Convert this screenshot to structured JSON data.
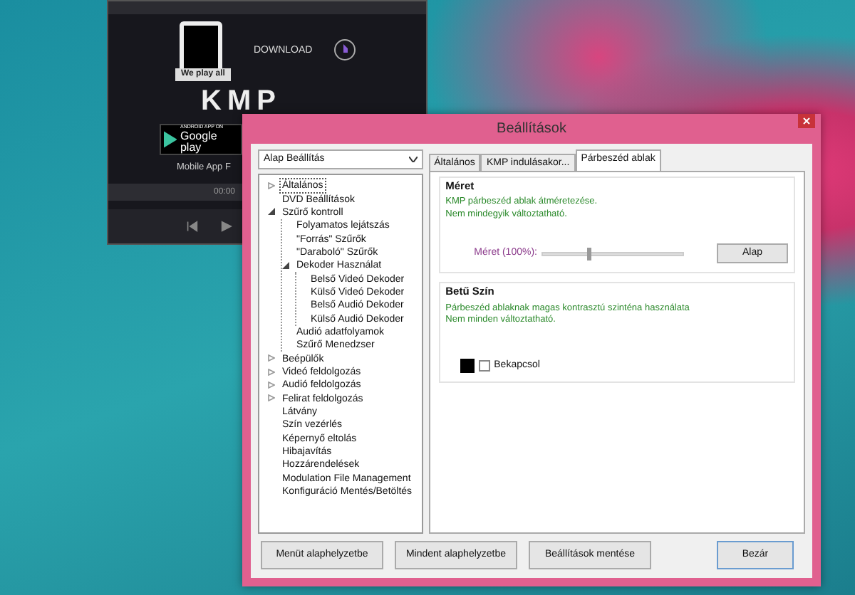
{
  "player": {
    "download_text": "DOWNLOAD",
    "ribbon": "We play all",
    "logo": "KMP",
    "store_small": "ANDROID APP ON",
    "store_name": "Google play",
    "mobile_text": "Mobile App F",
    "time": "00:00"
  },
  "dialog": {
    "title": "Beállítások",
    "preset": {
      "value": "Alap Beállítás"
    },
    "tree": [
      {
        "label": "Általános",
        "expanded": false,
        "selected": true
      },
      {
        "label": "DVD Beállítások",
        "selected": false
      },
      {
        "label": "Szűrő kontroll",
        "expanded": true,
        "selected": false,
        "children": [
          {
            "label": "Folyamatos lejátszás",
            "selected": false
          },
          {
            "label": "\"Forrás\" Szűrők",
            "selected": false
          },
          {
            "label": "\"Daraboló\" Szűrők",
            "selected": false
          },
          {
            "label": "Dekoder Használat",
            "expanded": true,
            "selected": false,
            "children": [
              {
                "label": "Belső Videó Dekoder",
                "selected": false
              },
              {
                "label": "Külső Videó Dekoder",
                "selected": false
              },
              {
                "label": "Belső Audió Dekoder",
                "selected": false
              },
              {
                "label": "Külső Audió Dekoder",
                "selected": false
              }
            ]
          },
          {
            "label": "Audió adatfolyamok",
            "selected": false
          },
          {
            "label": "Szűrő Menedzser",
            "selected": false
          }
        ]
      },
      {
        "label": "Beépülők",
        "expanded": false,
        "selected": false
      },
      {
        "label": "Videó feldolgozás",
        "expanded": false,
        "selected": false
      },
      {
        "label": "Audió feldolgozás",
        "expanded": false,
        "selected": false
      },
      {
        "label": "Felirat feldolgozás",
        "expanded": false,
        "selected": false
      },
      {
        "label": "Látvány",
        "selected": false
      },
      {
        "label": "Szín vezérlés",
        "selected": false
      },
      {
        "label": "Képernyő eltolás",
        "selected": false
      },
      {
        "label": "Hibajavítás",
        "selected": false
      },
      {
        "label": "Hozzárendelések",
        "selected": false
      },
      {
        "label": "Modulation File Management",
        "selected": false
      },
      {
        "label": "Konfiguráció Mentés/Betöltés",
        "selected": false
      }
    ],
    "tabs": [
      {
        "label": "Általános",
        "selected": false
      },
      {
        "label": "KMP indulásakor...",
        "selected": false
      },
      {
        "label": "Párbeszéd ablak",
        "selected": true
      }
    ],
    "size_group": {
      "title": "Méret",
      "description": [
        "KMP párbeszéd ablak átméretezése.",
        "Nem mindegyik változtatható."
      ],
      "slider_label": "Méret (100%):",
      "level": 0.33,
      "button": "Alap"
    },
    "font_color_group": {
      "title": "Betű Szín",
      "description": [
        "Párbeszéd ablaknak magas kontrasztú szinténa használata",
        "Nem minden változtatható."
      ],
      "color": "#000000",
      "checkbox": {
        "label": "Bekapcsol",
        "checked": false
      }
    },
    "buttons": [
      "Menüt alaphelyzetbe",
      "Mindent alaphelyzetbe",
      "Beállítások mentése",
      "Bezár"
    ]
  }
}
